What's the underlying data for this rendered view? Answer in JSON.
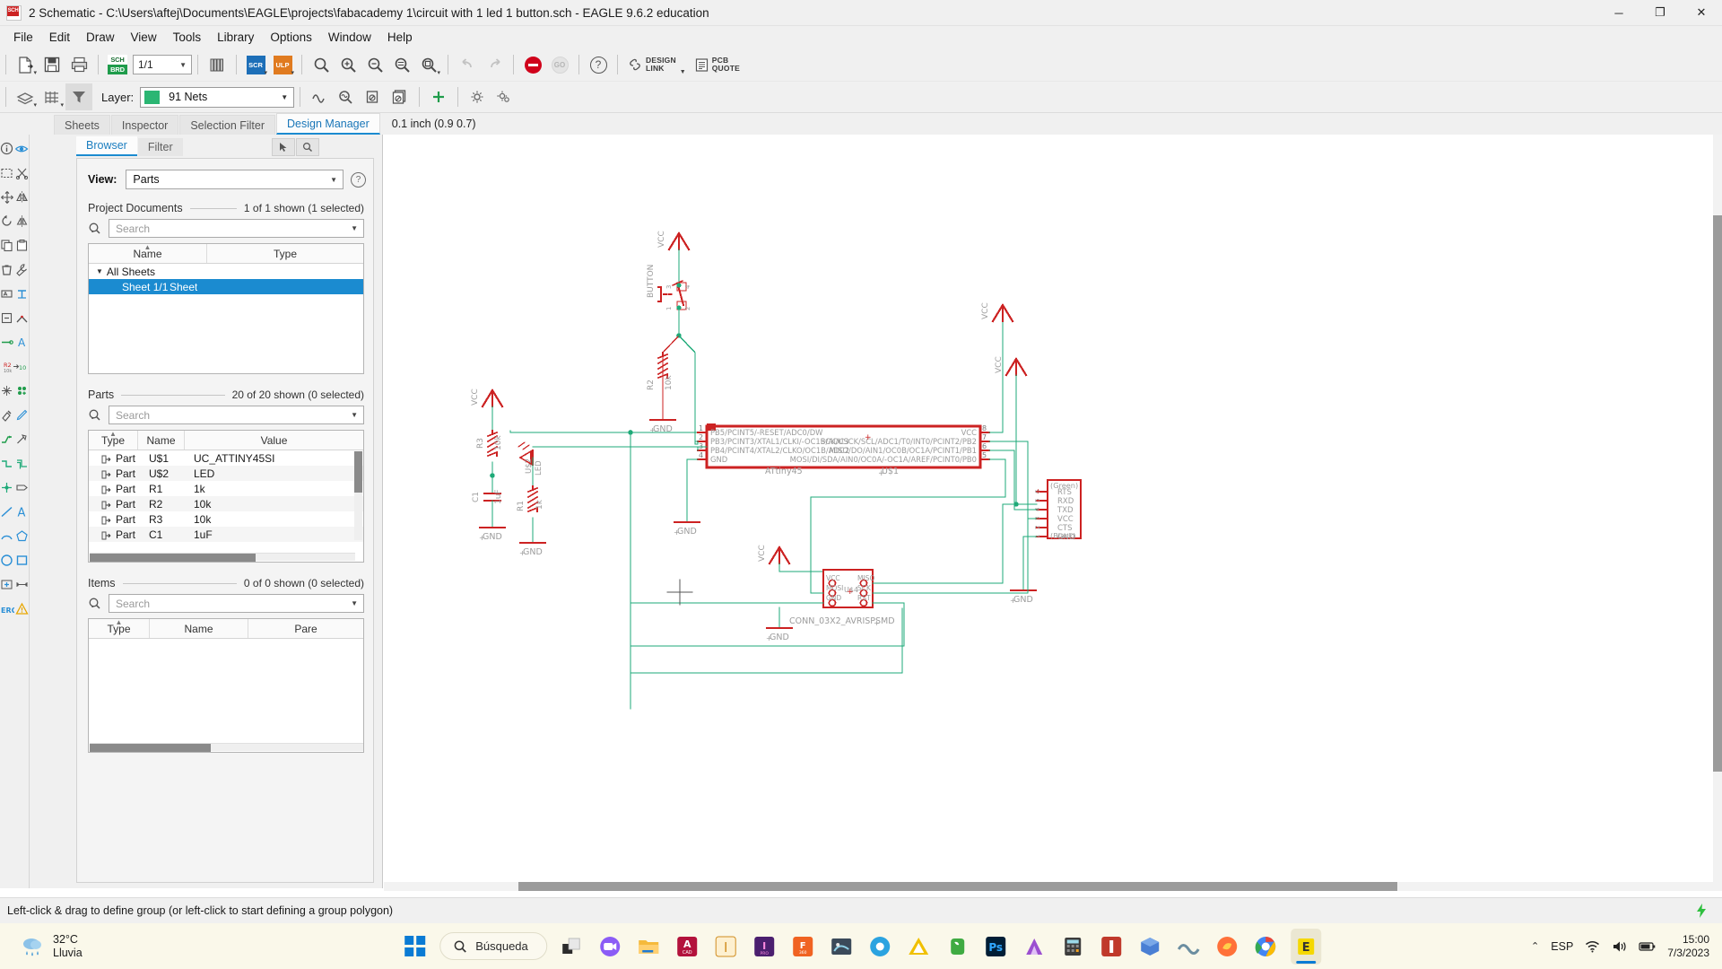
{
  "window": {
    "title": "2 Schematic - C:\\Users\\aftej\\Documents\\EAGLE\\projects\\fabacademy 1\\circuit with 1 led 1 button.sch - EAGLE 9.6.2 education",
    "icon_label": "SCH",
    "minimize": "─",
    "maximize": "❐",
    "close": "✕"
  },
  "menubar": {
    "items": [
      "File",
      "Edit",
      "Draw",
      "View",
      "Tools",
      "Library",
      "Options",
      "Window",
      "Help"
    ]
  },
  "toolbar": {
    "sheet_selector": "1/1",
    "sch_label": "SCH",
    "brd_label": "BRD",
    "scr_label": "SCR",
    "ulp_label": "ULP",
    "go_label": "GO",
    "help_label": "?",
    "design_link_line1": "DESIGN",
    "design_link_line2": "LINK",
    "pcb_quote_line1": "PCB",
    "pcb_quote_line2": "QUOTE"
  },
  "layerbar": {
    "label": "Layer:",
    "value": "91 Nets",
    "color": "#2bb673"
  },
  "tabs": {
    "items": [
      "Sheets",
      "Inspector",
      "Selection Filter",
      "Design Manager"
    ],
    "active": "Design Manager"
  },
  "coordinates": "0.1 inch (0.9 0.7)",
  "command_line": {
    "value": "",
    "placeholder": ""
  },
  "panel": {
    "subtabs": [
      "Browser",
      "Filter"
    ],
    "subtab_active": "Browser",
    "view_label": "View:",
    "view_value": "Parts",
    "help_label": "?",
    "project_documents": {
      "title": "Project Documents",
      "count": "1 of 1 shown (1 selected)",
      "search_placeholder": "Search",
      "columns": [
        "Name",
        "Type"
      ],
      "rows": [
        {
          "name": "All Sheets",
          "type": "",
          "group": true,
          "selected": false
        },
        {
          "name": "Sheet 1/1",
          "type": "Sheet",
          "group": false,
          "selected": true
        }
      ]
    },
    "parts": {
      "title": "Parts",
      "count": "20 of 20 shown (0 selected)",
      "search_placeholder": "Search",
      "columns": [
        "Type",
        "Name",
        "Value"
      ],
      "rows": [
        {
          "type": "Part",
          "name": "U$1",
          "value": "UC_ATTINY45SI"
        },
        {
          "type": "Part",
          "name": "U$2",
          "value": "LED"
        },
        {
          "type": "Part",
          "name": "R1",
          "value": "1k"
        },
        {
          "type": "Part",
          "name": "R2",
          "value": "10k"
        },
        {
          "type": "Part",
          "name": "R3",
          "value": "10k"
        },
        {
          "type": "Part",
          "name": "C1",
          "value": "1uF"
        }
      ]
    },
    "items": {
      "title": "Items",
      "count": "0 of 0 shown (0 selected)",
      "search_placeholder": "Search",
      "columns": [
        "Type",
        "Name",
        "Pare"
      ],
      "rows": []
    }
  },
  "statusbar": {
    "message": "Left-click & drag to define group (or left-click to start defining a group polygon)"
  },
  "taskbar": {
    "weather_temp": "32°C",
    "weather_desc": "Lluvia",
    "search_placeholder": "Búsqueda",
    "language": "ESP",
    "time": "15:00",
    "date": "7/3/2023",
    "app_icons": [
      "task-view",
      "teams",
      "file-explorer",
      "autocad",
      "illustrator",
      "indesign",
      "fusion360",
      "eagle-3d",
      "chrome-alt",
      "autodesk",
      "evernote",
      "photoshop",
      "krita",
      "calculator",
      "app-red",
      "package",
      "wave",
      "firefox",
      "chrome",
      "eagle"
    ]
  },
  "schematic": {
    "ic": {
      "name": "U$1",
      "value": "ATtiny45",
      "pins_left": [
        {
          "num": "1",
          "label": "PB5/PCINT5/-RESET/ADC0/DW"
        },
        {
          "num": "2",
          "label": "PB3/PCINT3/XTAL1/CLKI/-OC1B/ADC3"
        },
        {
          "num": "3",
          "label": "PB4/PCINT4/XTAL2/CLKO/OC1B/ADC2"
        },
        {
          "num": "4",
          "label": "GND"
        }
      ],
      "pins_right": [
        {
          "num": "8",
          "label": "VCC"
        },
        {
          "num": "7",
          "label": "SCK/USCK/SCL/ADC1/T0/INT0/PCINT2/PB2"
        },
        {
          "num": "6",
          "label": "MISO/DO/AIN1/OC0B/OC1A/PCINT1/PB1"
        },
        {
          "num": "5",
          "label": "MOSI/DI/SDA/AIN0/OC0A/-OC1A/AREF/PCINT0/PB0"
        }
      ]
    },
    "isp": {
      "name": "U$4",
      "value": "CONN_03X2_AVRISPSMD",
      "pins": [
        "VCC",
        "MISO",
        "MOSI",
        "SCK",
        "GND",
        "RST"
      ]
    },
    "ftdi": {
      "top_label": "(Green)",
      "bottom_label": "(Black)",
      "pins": [
        {
          "num": "6",
          "label": "RTS"
        },
        {
          "num": "5",
          "label": "RXD"
        },
        {
          "num": "4",
          "label": "TXD"
        },
        {
          "num": "3",
          "label": "VCC"
        },
        {
          "num": "2",
          "label": "CTS"
        },
        {
          "num": "1",
          "label": "GND"
        }
      ]
    },
    "components": [
      {
        "ref": "R1",
        "value": "1k"
      },
      {
        "ref": "R2",
        "value": "10k"
      },
      {
        "ref": "R3",
        "value": "10k"
      },
      {
        "ref": "C1",
        "value": "1uF"
      },
      {
        "ref": "U$2",
        "value": "LED"
      }
    ],
    "labels": {
      "button": "BUTTON",
      "vcc": "VCC",
      "gnd": "GND"
    },
    "colors": {
      "wire": "#1eaa78",
      "symbol": "#cc2222",
      "text": "#9b9b9b",
      "pin_text": "#9b9b9b"
    }
  }
}
